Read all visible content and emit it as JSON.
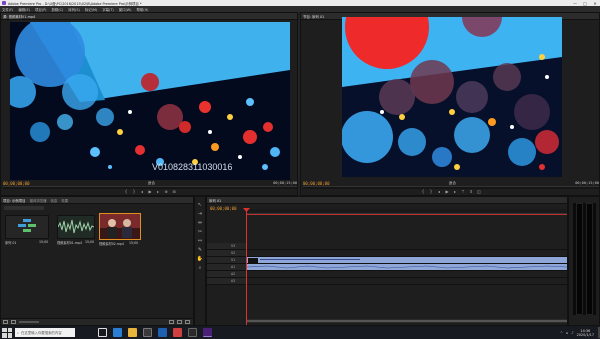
{
  "title_bar": {
    "title": "Adobe Premiere Pro - D:\\U盘\\PC\\2016\\2015\\02\\B\\Adobe Premiere Pro\\示例项目 *",
    "min": "—",
    "max": "□",
    "close": "✕"
  },
  "menu": [
    "文件(F)",
    "编辑(E)",
    "项目(P)",
    "剪辑(C)",
    "序列(S)",
    "标记(M)",
    "字幕(T)",
    "窗口(W)",
    "帮助(H)"
  ],
  "source_monitor": {
    "tab": "源: 视频素材01.mp4",
    "overlay_text": "V010828311030016",
    "timecode_in": "00;00;00;00",
    "fit": "适合",
    "timecode_dur": "00;00;15;00"
  },
  "program_monitor": {
    "tab": "节目: 序列 01",
    "timecode_in": "00;00;00;00",
    "fit": "适合",
    "timecode_dur": "00;00;15;00"
  },
  "project_panel": {
    "tabs": [
      "项目: 示例项目",
      "媒体浏览器",
      "信息",
      "效果"
    ],
    "items": [
      {
        "name": "序列 01",
        "meta": "15;00"
      },
      {
        "name": "视频素材01.mp4",
        "meta": "15;00"
      },
      {
        "name": "视频素材02.mp4",
        "meta": "15;00"
      }
    ]
  },
  "timeline": {
    "tab": "序列 01",
    "timecode": "00;00;00;00",
    "tracks": [
      {
        "id": "V3",
        "label": "V3"
      },
      {
        "id": "V2",
        "label": "V2"
      },
      {
        "id": "V1",
        "label": "V1"
      },
      {
        "id": "A1",
        "label": "A1"
      },
      {
        "id": "A2",
        "label": "A2"
      },
      {
        "id": "A3",
        "label": "A3"
      }
    ]
  },
  "taskbar": {
    "search_placeholder": "在这里输入你要搜索的内容",
    "time": "14:36",
    "date": "2020/1/17"
  },
  "colors": {
    "accent": "#e09020",
    "timecode": "#f0a030",
    "clip": "#8fa6d9",
    "playhead": "#e03030"
  }
}
